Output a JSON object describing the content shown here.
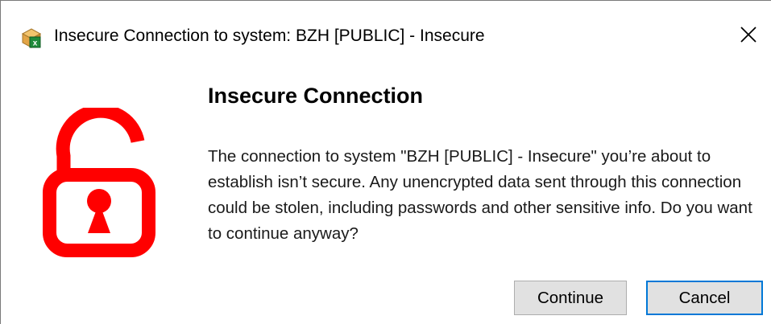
{
  "window": {
    "title": "Insecure Connection to system: BZH [PUBLIC] - Insecure",
    "app_icon": "sap-logon-icon",
    "close_icon": "close-icon"
  },
  "content": {
    "icon": "unlocked-padlock-icon",
    "heading": "Insecure Connection",
    "message": "The connection to system \"BZH [PUBLIC] - Insecure\" you’re about to establish isn’t secure. Any unencrypted data sent through this connection could be stolen, including passwords and other sensitive info. Do you want to continue anyway?"
  },
  "buttons": {
    "continue_label": "Continue",
    "cancel_label": "Cancel"
  },
  "colors": {
    "lock_red": "#ff0000",
    "focus_border": "#0078d7",
    "button_face": "#e1e1e1"
  }
}
